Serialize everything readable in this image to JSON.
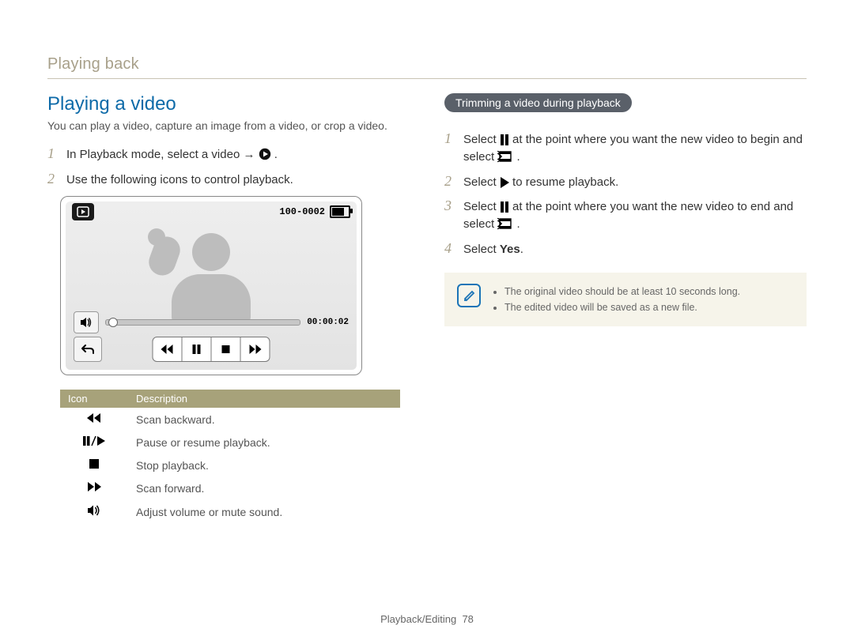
{
  "breadcrumb": "Playing back",
  "left": {
    "heading": "Playing a video",
    "intro": "You can play a video, capture an image from a video, or crop a video.",
    "steps": {
      "1": {
        "num": "1",
        "prefix": "In Playback mode, select a video → ",
        "icon": "play-circle-icon",
        "suffix": "."
      },
      "2": {
        "num": "2",
        "text": "Use the following icons to control playback."
      }
    },
    "screenshot": {
      "file_index": "100-0002",
      "time": "00:00:02",
      "icons": {
        "top_left": "play-mode-icon",
        "battery": "battery-icon",
        "sound": "speaker-icon",
        "back": "back-arrow-icon",
        "rewind": "scan-backward-icon",
        "pause": "pause-icon",
        "stop": "stop-icon",
        "forward": "scan-forward-icon"
      }
    },
    "table": {
      "headers": {
        "icon": "Icon",
        "desc": "Description"
      },
      "rows": [
        {
          "icon": "scan-backward-icon",
          "desc": "Scan backward."
        },
        {
          "icon": "pause-play-icon",
          "desc": "Pause or resume playback."
        },
        {
          "icon": "stop-icon",
          "desc": "Stop playback."
        },
        {
          "icon": "scan-forward-icon",
          "desc": "Scan forward."
        },
        {
          "icon": "speaker-icon",
          "desc": "Adjust volume or mute sound."
        }
      ]
    }
  },
  "right": {
    "pill": "Trimming a video during playback",
    "steps": {
      "1": {
        "num": "1",
        "a": "Select ",
        "i1": "pause-icon",
        "b": " at the point where you want the new video to begin and select ",
        "i2": "trim-icon",
        "c": "."
      },
      "2": {
        "num": "2",
        "a": "Select ",
        "i1": "play-triangle-icon",
        "b": " to resume playback."
      },
      "3": {
        "num": "3",
        "a": "Select ",
        "i1": "pause-icon",
        "b": " at the point where you want the new video to end and select ",
        "i2": "trim-icon",
        "c": "."
      },
      "4": {
        "num": "4",
        "a": "Select ",
        "bold": "Yes",
        "b": "."
      }
    },
    "note": {
      "items": [
        "The original video should be at least 10 seconds long.",
        "The edited video will be saved as a new file."
      ]
    }
  },
  "footer": {
    "section": "Playback/Editing",
    "page": "78"
  }
}
